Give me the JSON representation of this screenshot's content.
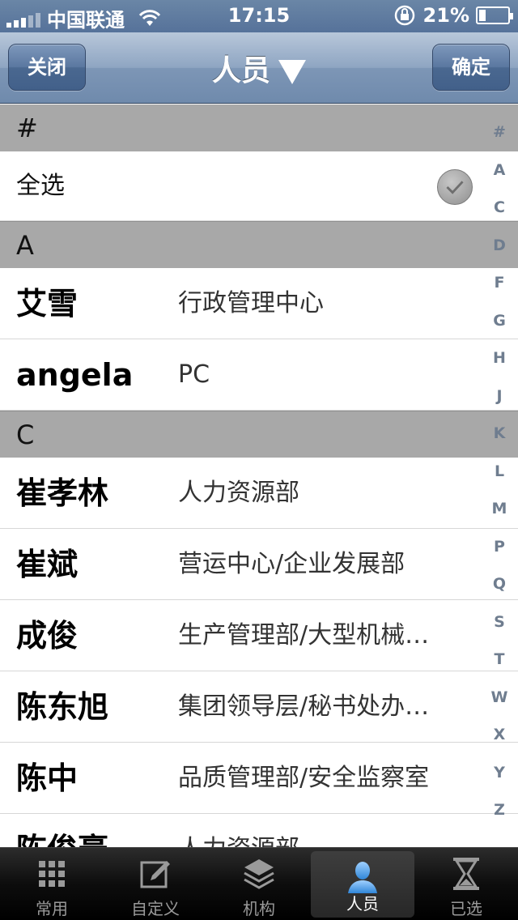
{
  "status": {
    "carrier": "中国联通",
    "time": "17:15",
    "battery": "21%",
    "battery_level": 0.21
  },
  "nav": {
    "left_label": "关闭",
    "title": "人员",
    "right_label": "确定"
  },
  "list": {
    "hash_header": "#",
    "select_all": "全选",
    "sections": [
      {
        "header": "A",
        "rows": [
          {
            "name": "艾雪",
            "dept": "行政管理中心"
          },
          {
            "name": "angela",
            "dept": "PC"
          }
        ]
      },
      {
        "header": "C",
        "rows": [
          {
            "name": "崔孝林",
            "dept": "人力资源部"
          },
          {
            "name": "崔斌",
            "dept": "营运中心/企业发展部"
          },
          {
            "name": "成俊",
            "dept": "生产管理部/大型机械…"
          },
          {
            "name": "陈东旭",
            "dept": "集团领导层/秘书处办…"
          },
          {
            "name": "陈中",
            "dept": "品质管理部/安全监察室"
          },
          {
            "name": "陈俊豪",
            "dept": "人力资源部"
          }
        ]
      }
    ]
  },
  "index": [
    "#",
    "A",
    "C",
    "D",
    "F",
    "G",
    "H",
    "J",
    "K",
    "L",
    "M",
    "P",
    "Q",
    "S",
    "T",
    "W",
    "X",
    "Y",
    "Z"
  ],
  "tabs": [
    {
      "label": "常用",
      "icon": "grid-icon"
    },
    {
      "label": "自定义",
      "icon": "edit-icon"
    },
    {
      "label": "机构",
      "icon": "layers-icon"
    },
    {
      "label": "人员",
      "icon": "person-icon"
    },
    {
      "label": "已选",
      "icon": "hourglass-icon"
    }
  ],
  "colors": {
    "tab_active": "#5aa8e8",
    "nav_accent": "#5a77a0"
  }
}
